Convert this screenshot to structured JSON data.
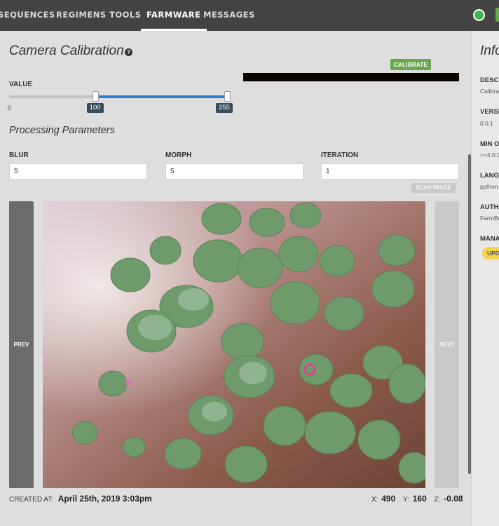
{
  "nav": {
    "items": [
      {
        "label": "SEQUENCES"
      },
      {
        "label": "REGIMENS"
      },
      {
        "label": "TOOLS"
      },
      {
        "label": "FARMWARE"
      },
      {
        "label": "MESSAGES"
      }
    ],
    "active": "FARMWARE"
  },
  "panel": {
    "title": "Camera Calibration",
    "help_icon": "?",
    "calibrate_label": "CALIBRATE",
    "value_label": "VALUE",
    "slider": {
      "min_label": "0",
      "low": 100,
      "high": 255,
      "low_label": "100",
      "high_label": "255",
      "range_min": 0,
      "range_max": 255
    },
    "section_title": "Processing Parameters",
    "fields": [
      {
        "label": "BLUR",
        "value": "5"
      },
      {
        "label": "MORPH",
        "value": "5"
      },
      {
        "label": "ITERATION",
        "value": "1"
      }
    ],
    "scan_label": "SCAN IMAGE",
    "prev_label": "PREV",
    "next_label": "NEXT",
    "created_label": "CREATED AT:",
    "created_value": "April 25th, 2019 3:03pm",
    "coords": {
      "x_label": "X:",
      "x": "490",
      "y_label": "Y:",
      "y": "160",
      "z_label": "Z:",
      "z": "-0.08"
    }
  },
  "info": {
    "title": "Info",
    "rows": [
      {
        "label": "DESCR",
        "value": "Calibra"
      },
      {
        "label": "VERSI",
        "value": "0.0.1"
      },
      {
        "label": "MIN O",
        "value": ">=4.0.0"
      },
      {
        "label": "LANGU",
        "value": "python"
      },
      {
        "label": "AUTHO",
        "value": "FarmBo"
      },
      {
        "label": "MANA",
        "value": ""
      }
    ],
    "update_label": "UPD"
  },
  "colors": {
    "nav_bg": "#434343",
    "accent_green": "#6aa84f",
    "slider_blue": "#2a7fd3",
    "update_yellow": "#f3d34a"
  },
  "icons": {
    "help": "help-icon",
    "status": "status-dot-icon"
  }
}
